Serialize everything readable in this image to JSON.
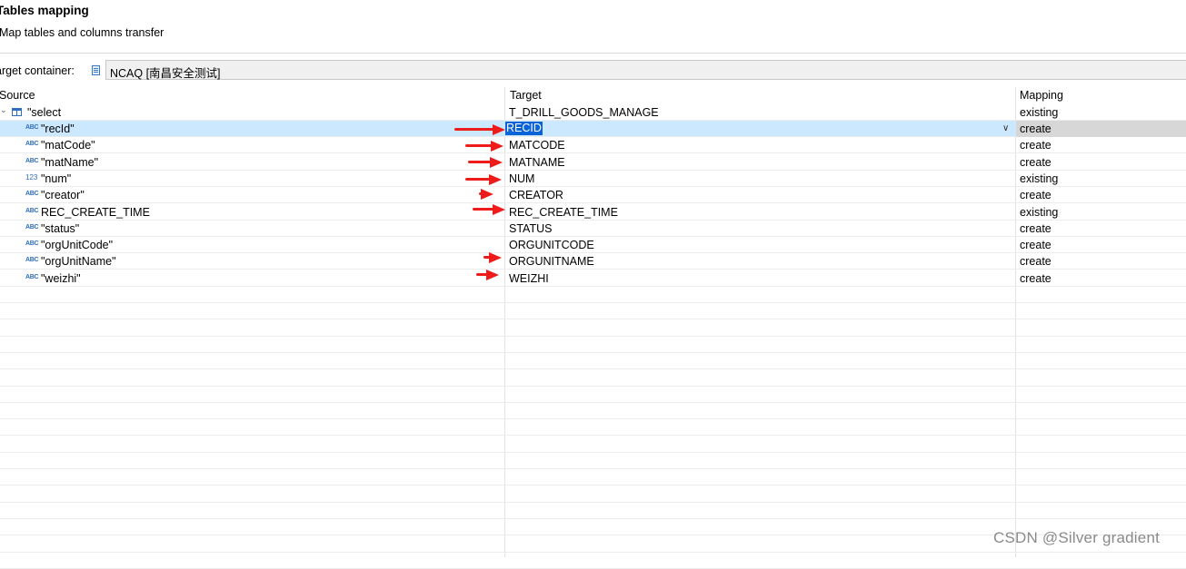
{
  "page": {
    "title": "Tables mapping",
    "subtitle": "Map tables and columns transfer"
  },
  "target_container": {
    "label": "arget container:",
    "value": "NCAQ  [南昌安全测试]",
    "icon": "database-icon"
  },
  "columns": {
    "source": "Source",
    "target": "Target",
    "mapping": "Mapping"
  },
  "table_row": {
    "source": "\"select",
    "target": "T_DRILL_GOODS_MANAGE",
    "mapping": "existing"
  },
  "rows": [
    {
      "type": "ABC",
      "source": "\"recId\"",
      "target": "RECID",
      "mapping": "create",
      "selected": true
    },
    {
      "type": "ABC",
      "source": "\"matCode\"",
      "target": "MATCODE",
      "mapping": "create"
    },
    {
      "type": "ABC",
      "source": "\"matName\"",
      "target": "MATNAME",
      "mapping": "create"
    },
    {
      "type": "123",
      "source": "\"num\"",
      "target": "NUM",
      "mapping": "existing"
    },
    {
      "type": "ABC",
      "source": "\"creator\"",
      "target": "CREATOR",
      "mapping": "create"
    },
    {
      "type": "ABC",
      "source": "REC_CREATE_TIME",
      "target": "REC_CREATE_TIME",
      "mapping": "existing"
    },
    {
      "type": "ABC",
      "source": "\"status\"",
      "target": "STATUS",
      "mapping": "create"
    },
    {
      "type": "ABC",
      "source": "\"orgUnitCode\"",
      "target": "ORGUNITCODE",
      "mapping": "create"
    },
    {
      "type": "ABC",
      "source": "\"orgUnitName\"",
      "target": "ORGUNITNAME",
      "mapping": "create"
    },
    {
      "type": "ABC",
      "source": "\"weizhi\"",
      "target": "WEIZHI",
      "mapping": "create"
    }
  ],
  "watermark": "CSDN @Silver gradient",
  "colors": {
    "selection": "#cce8ff",
    "highlight": "#0a64d8",
    "annotation_arrow": "#ee1b1b",
    "type_icon": "#2f6fbf"
  }
}
